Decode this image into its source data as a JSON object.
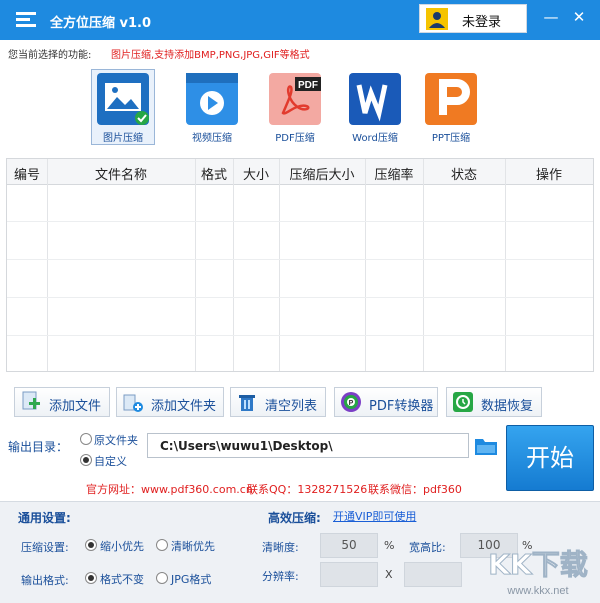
{
  "titlebar": {
    "title": "全方位压缩 v1.0",
    "login_label": "未登录",
    "minimize": "—",
    "close": "✕"
  },
  "functions": {
    "label": "您当前选择的功能:",
    "description": "图片压缩,支持添加BMP,PNG,JPG,GIF等格式",
    "tools": [
      {
        "label": "图片压缩",
        "icon": "image-compress-icon",
        "selected": true
      },
      {
        "label": "视频压缩",
        "icon": "video-compress-icon"
      },
      {
        "label": "PDF压缩",
        "icon": "pdf-compress-icon"
      },
      {
        "label": "Word压缩",
        "icon": "word-compress-icon"
      },
      {
        "label": "PPT压缩",
        "icon": "ppt-compress-icon"
      }
    ]
  },
  "table": {
    "columns": [
      "编号",
      "文件名称",
      "格式",
      "大小",
      "压缩后大小",
      "压缩率",
      "状态",
      "操作"
    ]
  },
  "actions": {
    "add_file": "添加文件",
    "add_folder": "添加文件夹",
    "clear_list": "清空列表",
    "pdf_converter": "PDF转换器",
    "data_recovery": "数据恢复"
  },
  "output": {
    "label": "输出目录：",
    "option_original": "原文件夹",
    "option_custom": "自定义",
    "selected": "custom",
    "path": "C:\\Users\\wuwu1\\Desktop\\",
    "start": "开始"
  },
  "contact": {
    "website": "官方网址：www.pdf360.com.cn",
    "qq": "联系QQ：1328271526",
    "wechat": "联系微信：pdf360"
  },
  "settings": {
    "general_title": "通用设置:",
    "compress_label": "压缩设置:",
    "compress_opt1": "缩小优先",
    "compress_opt2": "清晰优先",
    "format_label": "输出格式:",
    "format_opt1": "格式不变",
    "format_opt2": "JPG格式",
    "efficient_title": "高效压缩:",
    "vip_link": "开通VIP即可使用",
    "clarity_label": "清晰度:",
    "clarity_value": "50",
    "clarity_unit": "%",
    "ratio_label": "宽高比:",
    "ratio_value": "100",
    "ratio_unit": "%",
    "resolution_label": "分辨率:",
    "resolution_x": "X",
    "watermark": "KK下载",
    "watermark_url": "www.kkx.net"
  },
  "colors": {
    "brand": "#1e8ae0",
    "accent_red": "#e02020",
    "link": "#1a4f9a"
  }
}
